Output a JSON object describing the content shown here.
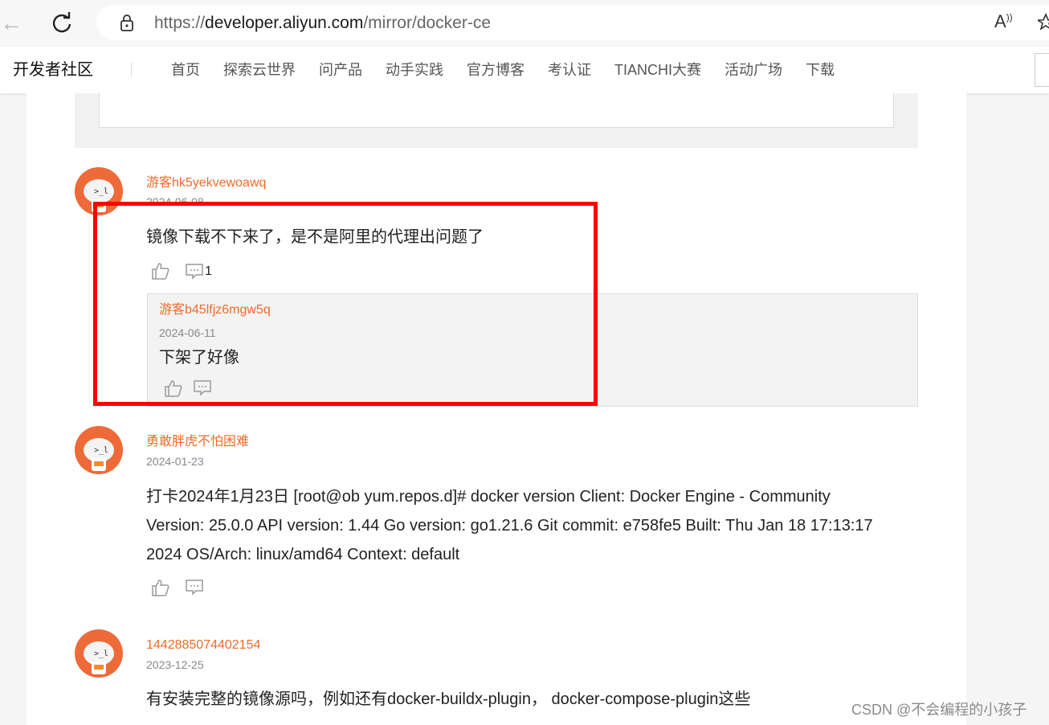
{
  "browser": {
    "url_scheme": "https://",
    "url_host": "developer.aliyun.com",
    "url_path": "/mirror/docker-ce",
    "read_aloud_label": "A)"
  },
  "site": {
    "brand": "开发者社区",
    "nav": [
      "首页",
      "探索云世界",
      "问产品",
      "动手实践",
      "官方博客",
      "考认证",
      "TIANCHI大赛",
      "活动广场",
      "下载"
    ]
  },
  "comments": [
    {
      "user": "游客hk5yekvewoawq",
      "date": "2024-06-08",
      "text": "镜像下载不下来了，是不是阿里的代理出问题了",
      "reply_count": "1",
      "reply": {
        "user": "游客b45lfjz6mgw5q",
        "date": "2024-06-11",
        "text": "下架了好像"
      }
    },
    {
      "user": "勇敢胖虎不怕困难",
      "date": "2024-01-23",
      "text_lines": [
        "打卡2024年1月23日 [root@ob yum.repos.d]# docker version Client: Docker Engine - Community",
        "Version: 25.0.0 API version: 1.44 Go version: go1.21.6 Git commit: e758fe5 Built: Thu Jan 18 17:13:17",
        "2024 OS/Arch: linux/amd64 Context: default"
      ]
    },
    {
      "user": "1442885074402154",
      "date": "2023-12-25",
      "text": "有安装完整的镜像源吗，例如还有docker-buildx-plugin， docker-compose-plugin这些"
    }
  ],
  "watermark": "CSDN @不会编程的小孩子",
  "colors": {
    "accent": "#f06a2a",
    "highlight": "#ff0000",
    "avatar": "#ee6a38"
  }
}
